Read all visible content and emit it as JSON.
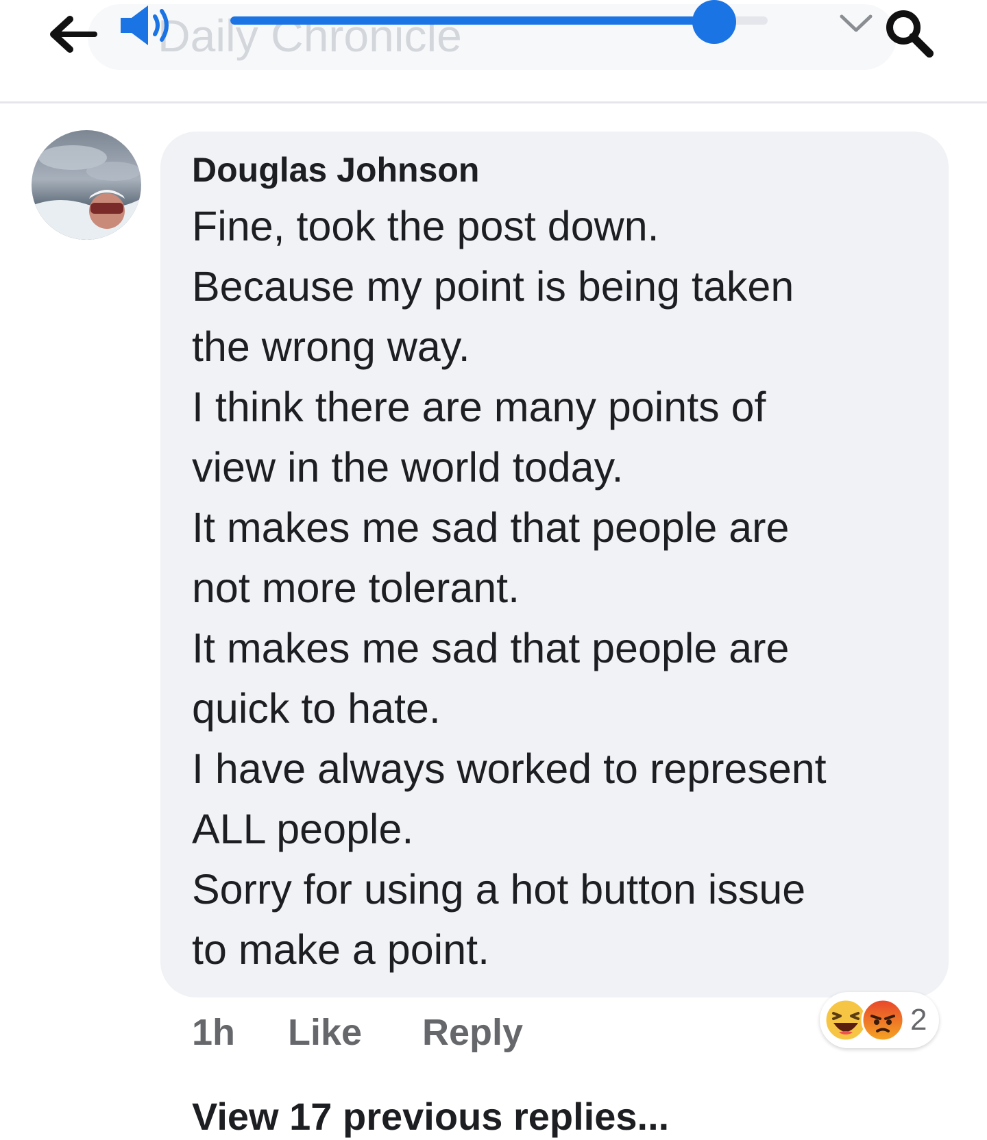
{
  "topbar": {
    "search_placeholder": "Daily Chronicle",
    "volume_level": 0.9,
    "icons": [
      "back-arrow-icon",
      "volume-icon",
      "chevron-down-icon",
      "search-icon"
    ],
    "accent_color": "#1b74e4"
  },
  "comment": {
    "author": "Douglas Johnson",
    "lines": [
      "Fine, took the post down.",
      "Because my point is being taken",
      "the wrong way.",
      "I think there are many points of",
      "view in the world today.",
      "It makes me sad that people are",
      "not more tolerant.",
      "It makes me sad that people are",
      "quick to hate.",
      "I have always worked to represent",
      "ALL people.",
      "Sorry for using a hot button issue",
      "to make a point."
    ],
    "actions": {
      "time": "1h",
      "like": "Like",
      "reply": "Reply"
    },
    "reactions": {
      "types": [
        "haha",
        "angry"
      ],
      "count": "2"
    }
  },
  "view_replies": "View 17 previous replies..."
}
